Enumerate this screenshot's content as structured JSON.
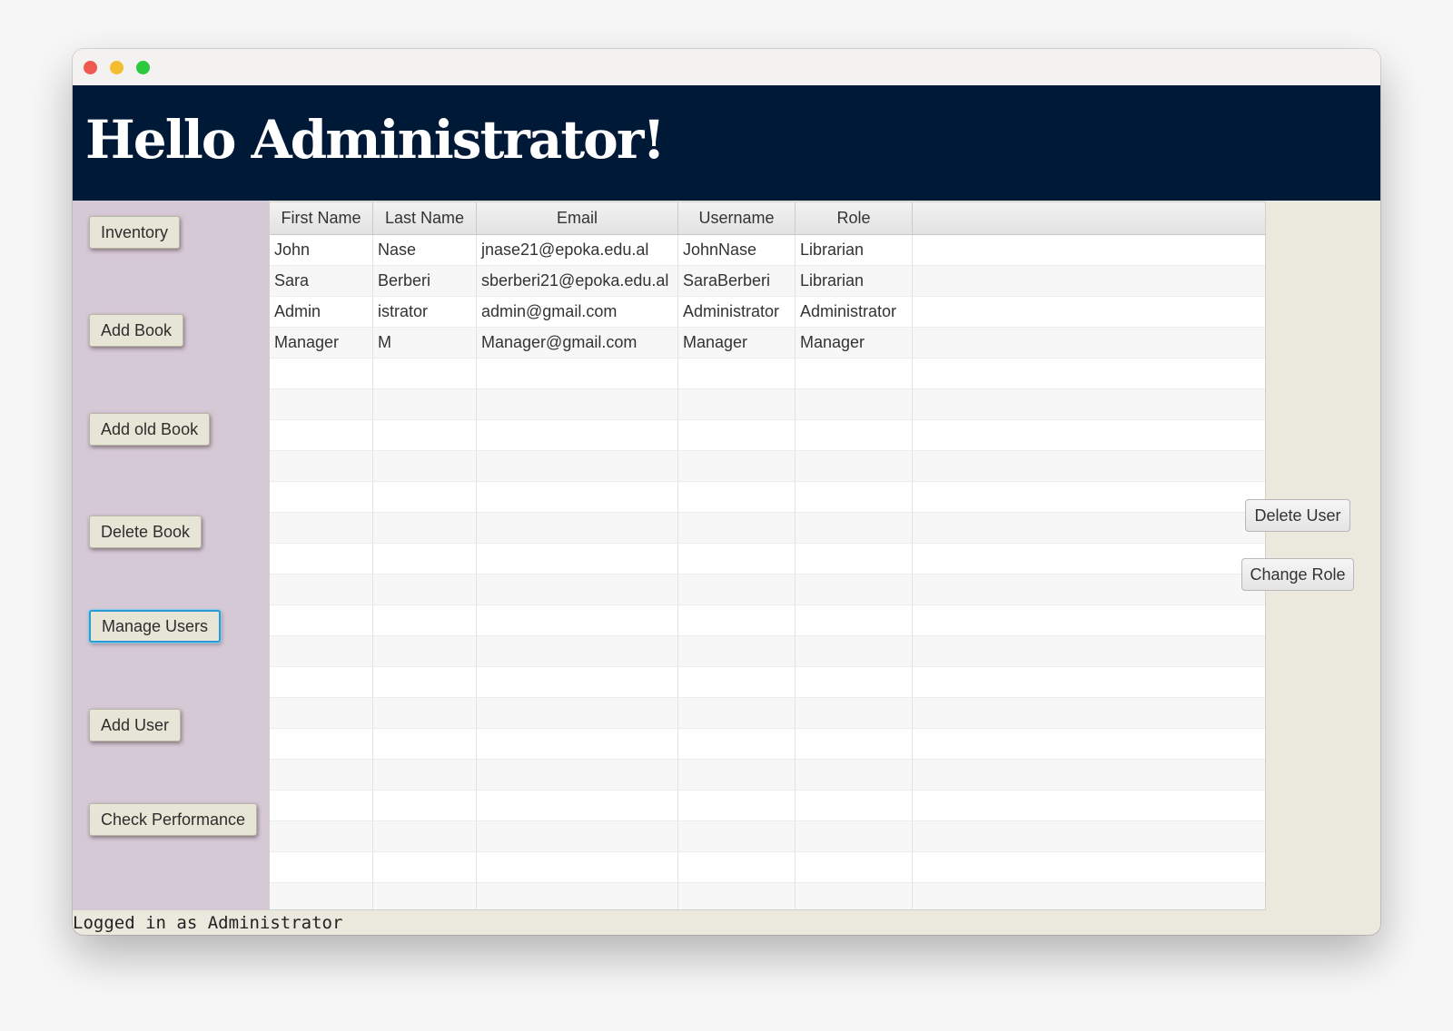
{
  "window": {
    "controls": [
      "close",
      "minimize",
      "maximize"
    ]
  },
  "header": {
    "title": "Hello Administrator!"
  },
  "sidebar": {
    "items": [
      {
        "label": "Inventory"
      },
      {
        "label": "Add Book"
      },
      {
        "label": "Add old Book"
      },
      {
        "label": "Delete Book"
      },
      {
        "label": "Manage Users",
        "focused": true
      },
      {
        "label": "Add User"
      },
      {
        "label": "Check Performance"
      }
    ]
  },
  "table": {
    "columns": [
      "First Name",
      "Last Name",
      "Email",
      "Username",
      "Role",
      ""
    ],
    "rows": [
      [
        "John",
        "Nase",
        "jnase21@epoka.edu.al",
        "JohnNase",
        "Librarian"
      ],
      [
        "Sara",
        "Berberi",
        "sberberi21@epoka.edu.al",
        "SaraBerberi",
        "Librarian"
      ],
      [
        "Admin",
        "istrator",
        "admin@gmail.com",
        "Administrator",
        "Administrator"
      ],
      [
        "Manager",
        "M",
        "Manager@gmail.com",
        "Manager",
        "Manager"
      ]
    ]
  },
  "actions": {
    "delete_user": "Delete User",
    "change_role": "Change Role"
  },
  "status": {
    "text": "Logged in as Administrator"
  },
  "colors": {
    "header_bg": "#001937",
    "sidebar_bg": "#d6c9d6",
    "focus_ring": "#2a9bd0"
  }
}
